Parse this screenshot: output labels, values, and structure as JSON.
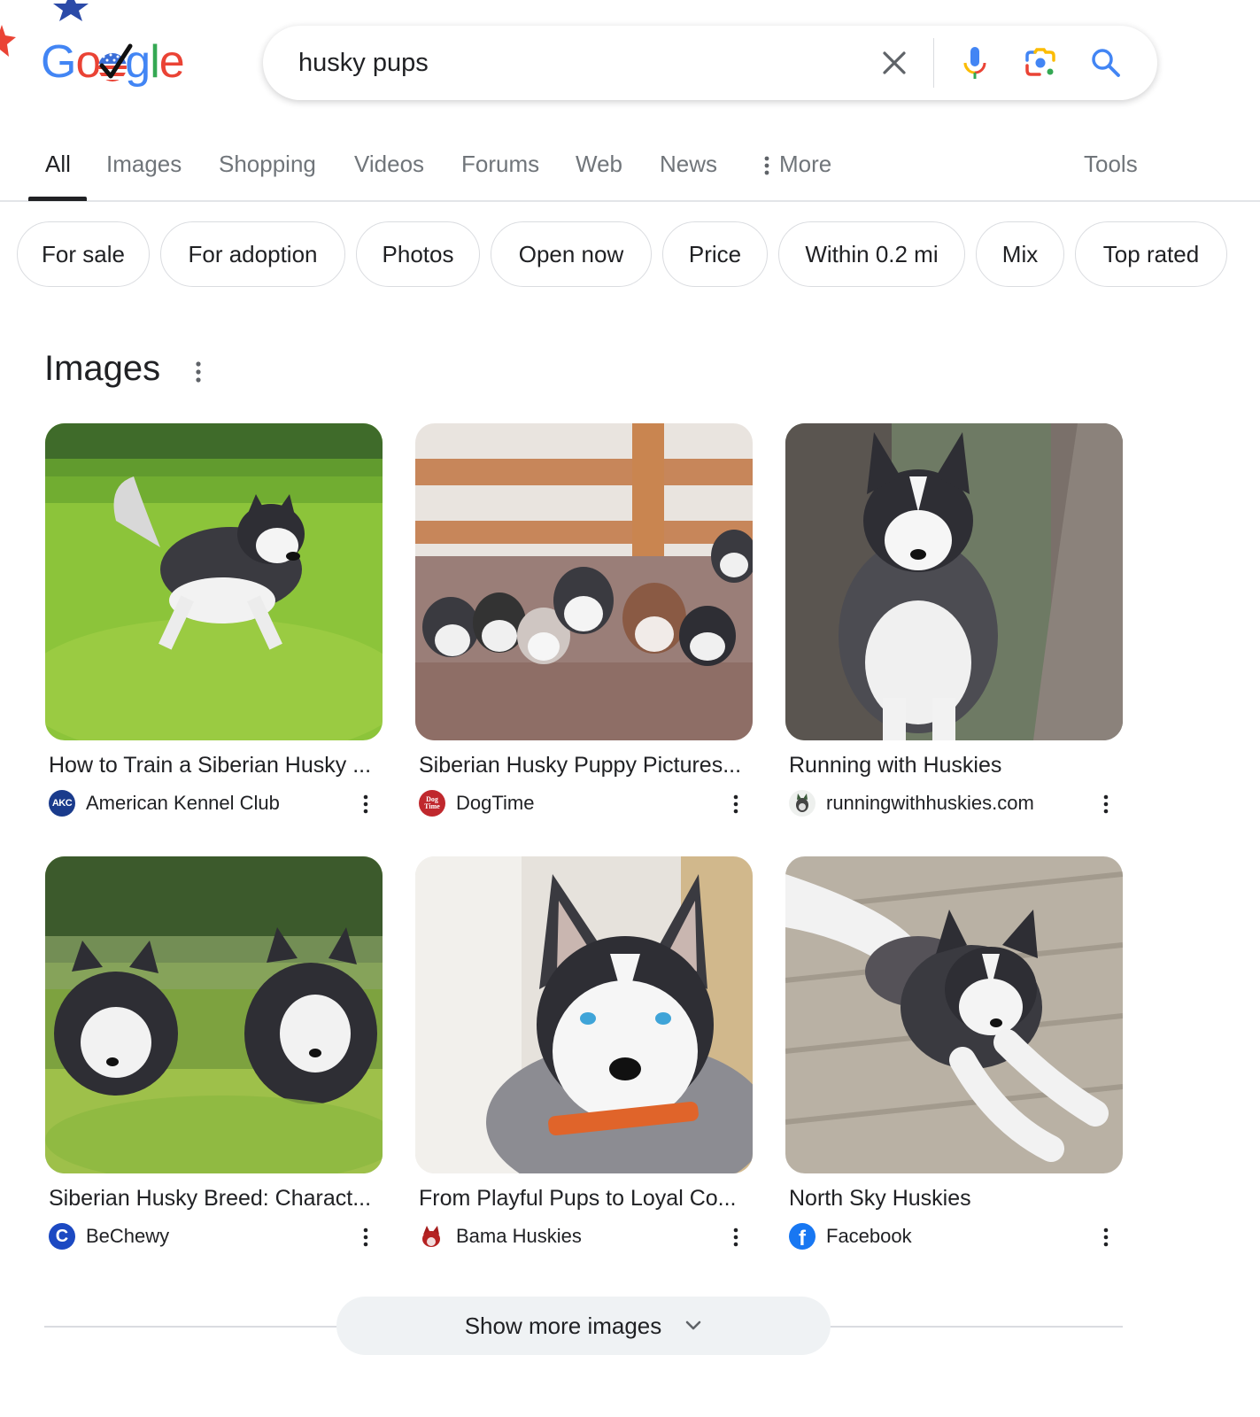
{
  "logo": {
    "text_letters": [
      "G",
      "o",
      "o",
      "g",
      "l",
      "e"
    ],
    "doodle_theme": "election-checkmark"
  },
  "search": {
    "query": "husky pups",
    "icons": [
      "clear-icon",
      "microphone-icon",
      "lens-camera-icon",
      "search-icon"
    ]
  },
  "tabs": {
    "items": [
      {
        "label": "All",
        "active": true
      },
      {
        "label": "Images"
      },
      {
        "label": "Shopping"
      },
      {
        "label": "Videos"
      },
      {
        "label": "Forums"
      },
      {
        "label": "Web"
      },
      {
        "label": "News"
      },
      {
        "label": "More"
      }
    ],
    "tools_label": "Tools"
  },
  "chips": [
    "For sale",
    "For adoption",
    "Photos",
    "Open now",
    "Price",
    "Within 0.2 mi",
    "Mix",
    "Top rated"
  ],
  "images_section": {
    "title": "Images",
    "results": [
      {
        "title": "How to Train a Siberian Husky ...",
        "source": "American Kennel Club",
        "favicon": "AKC",
        "scene": "puppy walking on grass"
      },
      {
        "title": "Siberian Husky Puppy Pictures...",
        "source": "DogTime",
        "favicon": "Dog Time",
        "scene": "litter of puppies on blanket by fence"
      },
      {
        "title": "Running with Huskies",
        "source": "runningwithhuskies.com",
        "favicon": "husky-head",
        "scene": "puppy between tree trunks"
      },
      {
        "title": "Siberian Husky Breed: Charact...",
        "source": "BeChewy",
        "favicon": "C",
        "scene": "two puppies in grass"
      },
      {
        "title": "From Playful Pups to Loyal Co...",
        "source": "Bama Huskies",
        "favicon": "red-husky",
        "scene": "blue-eyed puppy with orange collar"
      },
      {
        "title": "North Sky Huskies",
        "source": "Facebook",
        "favicon": "f",
        "scene": "puppy lying on wood floor"
      }
    ],
    "show_more_label": "Show more images"
  },
  "colors": {
    "google_blue": "#4285f4",
    "google_red": "#ea4335",
    "google_yellow": "#fbbc05",
    "google_green": "#34a853",
    "text_primary": "#202124",
    "text_secondary": "#70757a",
    "chip_border": "#dadce0",
    "show_more_bg": "#eff2f4"
  }
}
